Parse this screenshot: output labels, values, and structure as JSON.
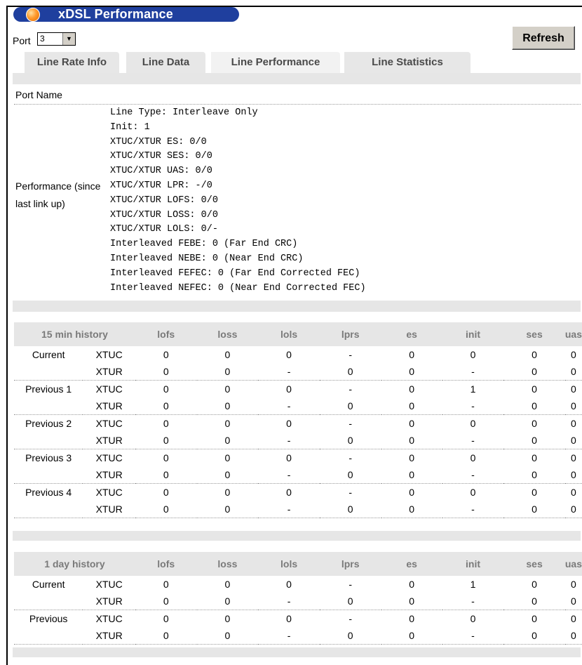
{
  "title": "xDSL Performance",
  "port": {
    "label": "Port",
    "value": "3"
  },
  "refresh_label": "Refresh",
  "tabs": [
    {
      "label": "Line Rate Info",
      "active": false
    },
    {
      "label": "Line Data",
      "active": false
    },
    {
      "label": "Line Performance",
      "active": true
    },
    {
      "label": "Line Statistics",
      "active": false
    }
  ],
  "port_name": {
    "label": "Port Name",
    "value": ""
  },
  "performance": {
    "label": "Performance (since last link up)",
    "lines": [
      "Line Type: Interleave Only",
      "Init: 1",
      "XTUC/XTUR ES: 0/0",
      "XTUC/XTUR SES: 0/0",
      "XTUC/XTUR UAS: 0/0",
      "XTUC/XTUR LPR: -/0",
      "XTUC/XTUR LOFS: 0/0",
      "XTUC/XTUR LOSS: 0/0",
      "XTUC/XTUR LOLS: 0/-",
      "Interleaved FEBE: 0 (Far End CRC)",
      "Interleaved NEBE: 0 (Near End CRC)",
      "Interleaved FEFEC: 0 (Far End Corrected FEC)",
      "Interleaved NEFEC: 0 (Near End Corrected FEC)"
    ]
  },
  "history_15min": {
    "header": [
      "15 min history",
      "lofs",
      "loss",
      "lols",
      "lprs",
      "es",
      "init",
      "ses",
      "uas"
    ],
    "groups": [
      {
        "name": "Current",
        "rows": [
          {
            "side": "XTUC",
            "values": [
              "0",
              "0",
              "0",
              "-",
              "0",
              "0",
              "0",
              "0"
            ]
          },
          {
            "side": "XTUR",
            "values": [
              "0",
              "0",
              "-",
              "0",
              "0",
              "-",
              "0",
              "0"
            ]
          }
        ]
      },
      {
        "name": "Previous 1",
        "rows": [
          {
            "side": "XTUC",
            "values": [
              "0",
              "0",
              "0",
              "-",
              "0",
              "1",
              "0",
              "0"
            ]
          },
          {
            "side": "XTUR",
            "values": [
              "0",
              "0",
              "-",
              "0",
              "0",
              "-",
              "0",
              "0"
            ]
          }
        ]
      },
      {
        "name": "Previous 2",
        "rows": [
          {
            "side": "XTUC",
            "values": [
              "0",
              "0",
              "0",
              "-",
              "0",
              "0",
              "0",
              "0"
            ]
          },
          {
            "side": "XTUR",
            "values": [
              "0",
              "0",
              "-",
              "0",
              "0",
              "-",
              "0",
              "0"
            ]
          }
        ]
      },
      {
        "name": "Previous 3",
        "rows": [
          {
            "side": "XTUC",
            "values": [
              "0",
              "0",
              "0",
              "-",
              "0",
              "0",
              "0",
              "0"
            ]
          },
          {
            "side": "XTUR",
            "values": [
              "0",
              "0",
              "-",
              "0",
              "0",
              "-",
              "0",
              "0"
            ]
          }
        ]
      },
      {
        "name": "Previous 4",
        "rows": [
          {
            "side": "XTUC",
            "values": [
              "0",
              "0",
              "0",
              "-",
              "0",
              "0",
              "0",
              "0"
            ]
          },
          {
            "side": "XTUR",
            "values": [
              "0",
              "0",
              "-",
              "0",
              "0",
              "-",
              "0",
              "0"
            ]
          }
        ]
      }
    ]
  },
  "history_1day": {
    "header": [
      "1 day history",
      "lofs",
      "loss",
      "lols",
      "lprs",
      "es",
      "init",
      "ses",
      "uas"
    ],
    "groups": [
      {
        "name": "Current",
        "rows": [
          {
            "side": "XTUC",
            "values": [
              "0",
              "0",
              "0",
              "-",
              "0",
              "1",
              "0",
              "0"
            ]
          },
          {
            "side": "XTUR",
            "values": [
              "0",
              "0",
              "-",
              "0",
              "0",
              "-",
              "0",
              "0"
            ]
          }
        ]
      },
      {
        "name": "Previous",
        "rows": [
          {
            "side": "XTUC",
            "values": [
              "0",
              "0",
              "0",
              "-",
              "0",
              "0",
              "0",
              "0"
            ]
          },
          {
            "side": "XTUR",
            "values": [
              "0",
              "0",
              "-",
              "0",
              "0",
              "-",
              "0",
              "0"
            ]
          }
        ]
      }
    ]
  }
}
